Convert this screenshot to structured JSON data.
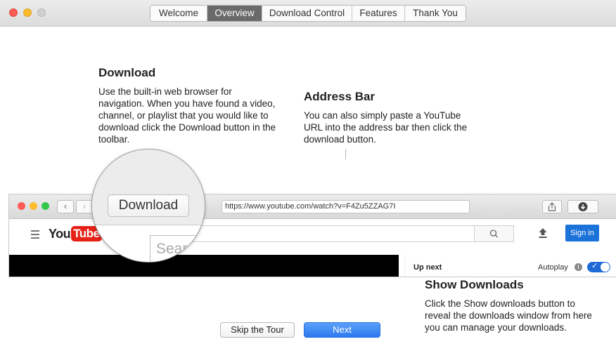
{
  "tabs": [
    {
      "label": "Welcome",
      "active": false
    },
    {
      "label": "Overview",
      "active": true
    },
    {
      "label": "Download Control",
      "active": false
    },
    {
      "label": "Features",
      "active": false
    },
    {
      "label": "Thank You",
      "active": false
    }
  ],
  "sections": {
    "download": {
      "title": "Download",
      "body": "Use the built-in web browser for navigation. When you have found a video, channel, or playlist that you would like to download click the Download button in the toolbar."
    },
    "address_bar": {
      "title": "Address Bar",
      "body": "You can also simply paste a YouTube URL into the address bar then click the download button."
    },
    "show_downloads": {
      "title": "Show Downloads",
      "body": "Click the Show downloads button to reveal the downloads window from here you can manage your downloads."
    }
  },
  "browser": {
    "url": "https://www.youtube.com/watch?v=F4Zu5ZZAG7I",
    "download_label": "Download",
    "search_placeholder": "Sear",
    "logo_you": "You",
    "logo_tube": "Tube",
    "sign_in": "Sign in",
    "up_next": "Up next",
    "autoplay": "Autoplay",
    "autoplay_on": true
  },
  "buttons": {
    "skip": "Skip the Tour",
    "next": "Next"
  },
  "colors": {
    "active_tab": "#6a6a6a",
    "primary_button": "#2c79f0",
    "youtube_red": "#e62117",
    "sign_in": "#1b72d8"
  }
}
